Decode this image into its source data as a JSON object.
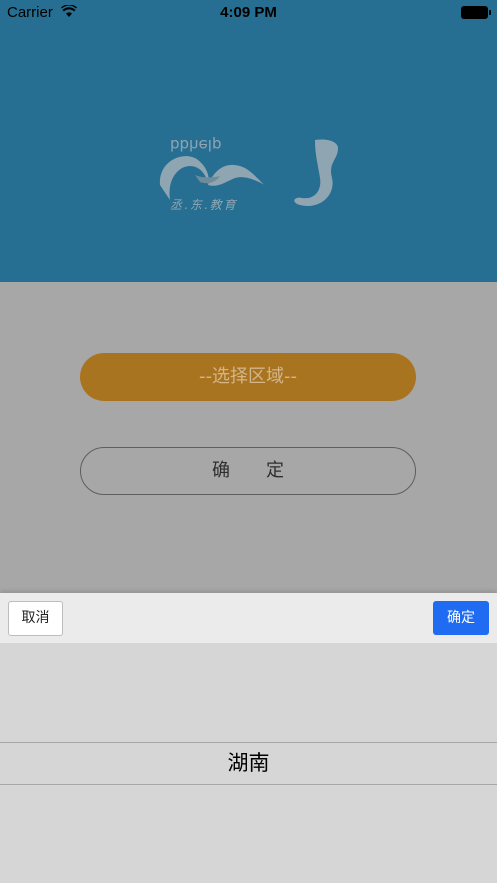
{
  "status_bar": {
    "carrier": "Carrier",
    "time": "4:09 PM"
  },
  "header": {
    "logo_text": "丞.东.教育",
    "logo_mark_text": "bbhelp"
  },
  "main": {
    "area_select_label": "--选择区域--",
    "confirm_label": "确　　定"
  },
  "picker": {
    "cancel_label": "取消",
    "ok_label": "确定",
    "selected_value": "湖南"
  },
  "colors": {
    "header_bg": "#276f92",
    "area_button_bg": "#a97420",
    "ok_button_bg": "#1f6cf2"
  }
}
